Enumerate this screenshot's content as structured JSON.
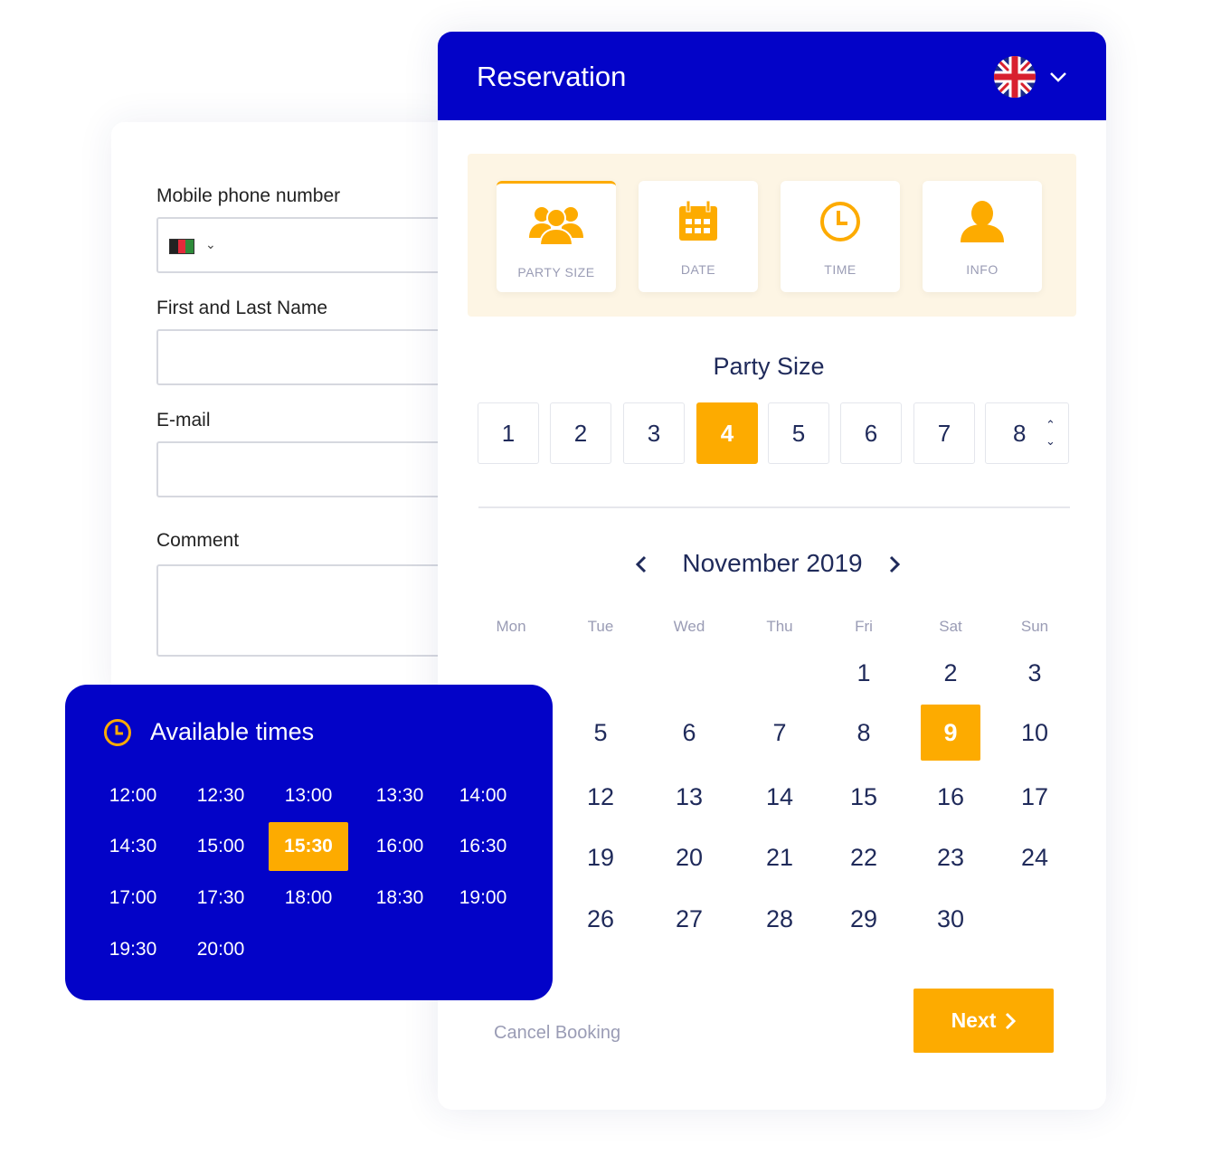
{
  "form": {
    "phone_label": "Mobile phone number",
    "name_label": "First and Last Name",
    "email_label": "E-mail",
    "comment_label": "Comment",
    "phone_value": "",
    "name_value": "",
    "email_value": "",
    "comment_value": ""
  },
  "header": {
    "title": "Reservation",
    "language": "English (UK)"
  },
  "steps": [
    {
      "label": "PARTY SIZE",
      "icon": "people-icon",
      "active": true
    },
    {
      "label": "DATE",
      "icon": "calendar-icon"
    },
    {
      "label": "TIME",
      "icon": "clock-icon"
    },
    {
      "label": "INFO",
      "icon": "user-icon"
    }
  ],
  "party": {
    "title": "Party Size",
    "sizes": [
      "1",
      "2",
      "3",
      "4",
      "5",
      "6",
      "7",
      "8"
    ],
    "selected": "4"
  },
  "calendar": {
    "month": "November 2019",
    "weekdays": [
      "Mon",
      "Tue",
      "Wed",
      "Thu",
      "Fri",
      "Sat",
      "Sun"
    ],
    "weeks": [
      [
        "",
        "",
        "",
        "",
        "1",
        "2",
        "3"
      ],
      [
        "",
        "5",
        "6",
        "7",
        "8",
        "9",
        "10"
      ],
      [
        "",
        "12",
        "13",
        "14",
        "15",
        "16",
        "17"
      ],
      [
        "",
        "19",
        "20",
        "21",
        "22",
        "23",
        "24"
      ],
      [
        "",
        "26",
        "27",
        "28",
        "29",
        "30",
        ""
      ]
    ],
    "selected": "9"
  },
  "times": {
    "title": "Available times",
    "slots": [
      "12:00",
      "12:30",
      "13:00",
      "13:30",
      "14:00",
      "14:30",
      "15:00",
      "15:30",
      "16:00",
      "16:30",
      "17:00",
      "17:30",
      "18:00",
      "18:30",
      "19:00",
      "19:30",
      "20:00"
    ],
    "selected": "15:30"
  },
  "footer": {
    "cancel": "Cancel Booking",
    "next": "Next"
  },
  "colors": {
    "primary": "#0303c8",
    "accent": "#fdab00"
  }
}
